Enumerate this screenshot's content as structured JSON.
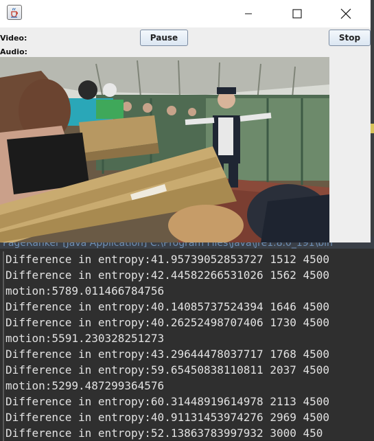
{
  "console": {
    "header_text": "PageRanker [Java Application] C:\\Program Files\\Java\\jre1.8.0_191\\bin",
    "lines": [
      "Difference in entropy:41.95739052853727 1512 4500",
      "Difference in entropy:42.44582266531026 1562 4500",
      "motion:5789.011466784756",
      "Difference in entropy:40.14085737524394 1646 4500",
      "Difference in entropy:40.26252498707406 1730 4500",
      "motion:5591.230328251273",
      "Difference in entropy:43.29644478037717 1768 4500",
      "Difference in entropy:59.65450838110811 2037 4500",
      "motion:5299.487299364576",
      "Difference in entropy:60.31448919614978 2113 4500",
      "Difference in entropy:40.91131453974276 2969 4500",
      "Difference in entropy:52.13863783997932 3000 450"
    ]
  },
  "window": {
    "app_icon": "java-coffee-cup-icon",
    "controls": {
      "minimize_icon": "minimize-icon",
      "maximize_icon": "maximize-icon",
      "close_icon": "close-icon"
    },
    "video_label": "Video:",
    "audio_label": "Audio:",
    "pause_label": "Pause",
    "stop_label": "Stop"
  }
}
